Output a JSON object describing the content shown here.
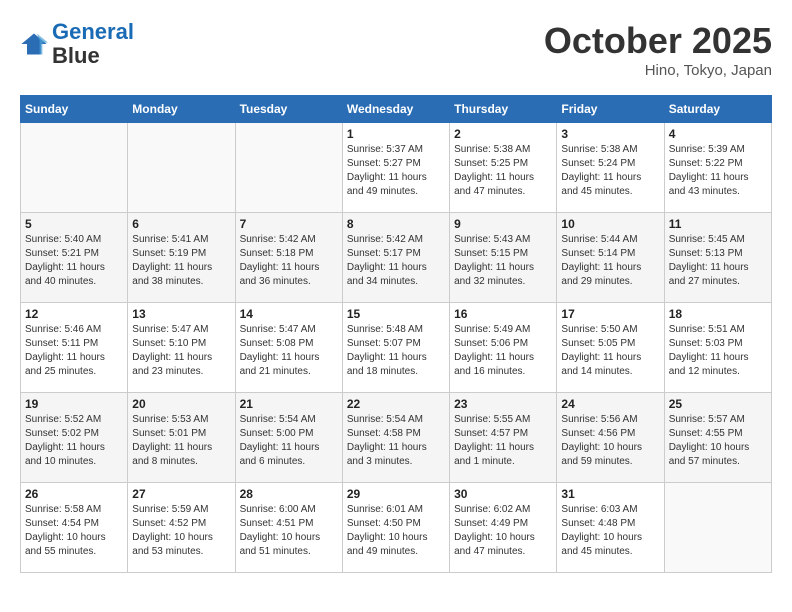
{
  "header": {
    "logo_line1": "General",
    "logo_line2": "Blue",
    "month_title": "October 2025",
    "subtitle": "Hino, Tokyo, Japan"
  },
  "weekdays": [
    "Sunday",
    "Monday",
    "Tuesday",
    "Wednesday",
    "Thursday",
    "Friday",
    "Saturday"
  ],
  "weeks": [
    [
      {
        "day": "",
        "info": ""
      },
      {
        "day": "",
        "info": ""
      },
      {
        "day": "",
        "info": ""
      },
      {
        "day": "1",
        "info": "Sunrise: 5:37 AM\nSunset: 5:27 PM\nDaylight: 11 hours and 49 minutes."
      },
      {
        "day": "2",
        "info": "Sunrise: 5:38 AM\nSunset: 5:25 PM\nDaylight: 11 hours and 47 minutes."
      },
      {
        "day": "3",
        "info": "Sunrise: 5:38 AM\nSunset: 5:24 PM\nDaylight: 11 hours and 45 minutes."
      },
      {
        "day": "4",
        "info": "Sunrise: 5:39 AM\nSunset: 5:22 PM\nDaylight: 11 hours and 43 minutes."
      }
    ],
    [
      {
        "day": "5",
        "info": "Sunrise: 5:40 AM\nSunset: 5:21 PM\nDaylight: 11 hours and 40 minutes."
      },
      {
        "day": "6",
        "info": "Sunrise: 5:41 AM\nSunset: 5:19 PM\nDaylight: 11 hours and 38 minutes."
      },
      {
        "day": "7",
        "info": "Sunrise: 5:42 AM\nSunset: 5:18 PM\nDaylight: 11 hours and 36 minutes."
      },
      {
        "day": "8",
        "info": "Sunrise: 5:42 AM\nSunset: 5:17 PM\nDaylight: 11 hours and 34 minutes."
      },
      {
        "day": "9",
        "info": "Sunrise: 5:43 AM\nSunset: 5:15 PM\nDaylight: 11 hours and 32 minutes."
      },
      {
        "day": "10",
        "info": "Sunrise: 5:44 AM\nSunset: 5:14 PM\nDaylight: 11 hours and 29 minutes."
      },
      {
        "day": "11",
        "info": "Sunrise: 5:45 AM\nSunset: 5:13 PM\nDaylight: 11 hours and 27 minutes."
      }
    ],
    [
      {
        "day": "12",
        "info": "Sunrise: 5:46 AM\nSunset: 5:11 PM\nDaylight: 11 hours and 25 minutes."
      },
      {
        "day": "13",
        "info": "Sunrise: 5:47 AM\nSunset: 5:10 PM\nDaylight: 11 hours and 23 minutes."
      },
      {
        "day": "14",
        "info": "Sunrise: 5:47 AM\nSunset: 5:08 PM\nDaylight: 11 hours and 21 minutes."
      },
      {
        "day": "15",
        "info": "Sunrise: 5:48 AM\nSunset: 5:07 PM\nDaylight: 11 hours and 18 minutes."
      },
      {
        "day": "16",
        "info": "Sunrise: 5:49 AM\nSunset: 5:06 PM\nDaylight: 11 hours and 16 minutes."
      },
      {
        "day": "17",
        "info": "Sunrise: 5:50 AM\nSunset: 5:05 PM\nDaylight: 11 hours and 14 minutes."
      },
      {
        "day": "18",
        "info": "Sunrise: 5:51 AM\nSunset: 5:03 PM\nDaylight: 11 hours and 12 minutes."
      }
    ],
    [
      {
        "day": "19",
        "info": "Sunrise: 5:52 AM\nSunset: 5:02 PM\nDaylight: 11 hours and 10 minutes."
      },
      {
        "day": "20",
        "info": "Sunrise: 5:53 AM\nSunset: 5:01 PM\nDaylight: 11 hours and 8 minutes."
      },
      {
        "day": "21",
        "info": "Sunrise: 5:54 AM\nSunset: 5:00 PM\nDaylight: 11 hours and 6 minutes."
      },
      {
        "day": "22",
        "info": "Sunrise: 5:54 AM\nSunset: 4:58 PM\nDaylight: 11 hours and 3 minutes."
      },
      {
        "day": "23",
        "info": "Sunrise: 5:55 AM\nSunset: 4:57 PM\nDaylight: 11 hours and 1 minute."
      },
      {
        "day": "24",
        "info": "Sunrise: 5:56 AM\nSunset: 4:56 PM\nDaylight: 10 hours and 59 minutes."
      },
      {
        "day": "25",
        "info": "Sunrise: 5:57 AM\nSunset: 4:55 PM\nDaylight: 10 hours and 57 minutes."
      }
    ],
    [
      {
        "day": "26",
        "info": "Sunrise: 5:58 AM\nSunset: 4:54 PM\nDaylight: 10 hours and 55 minutes."
      },
      {
        "day": "27",
        "info": "Sunrise: 5:59 AM\nSunset: 4:52 PM\nDaylight: 10 hours and 53 minutes."
      },
      {
        "day": "28",
        "info": "Sunrise: 6:00 AM\nSunset: 4:51 PM\nDaylight: 10 hours and 51 minutes."
      },
      {
        "day": "29",
        "info": "Sunrise: 6:01 AM\nSunset: 4:50 PM\nDaylight: 10 hours and 49 minutes."
      },
      {
        "day": "30",
        "info": "Sunrise: 6:02 AM\nSunset: 4:49 PM\nDaylight: 10 hours and 47 minutes."
      },
      {
        "day": "31",
        "info": "Sunrise: 6:03 AM\nSunset: 4:48 PM\nDaylight: 10 hours and 45 minutes."
      },
      {
        "day": "",
        "info": ""
      }
    ]
  ]
}
